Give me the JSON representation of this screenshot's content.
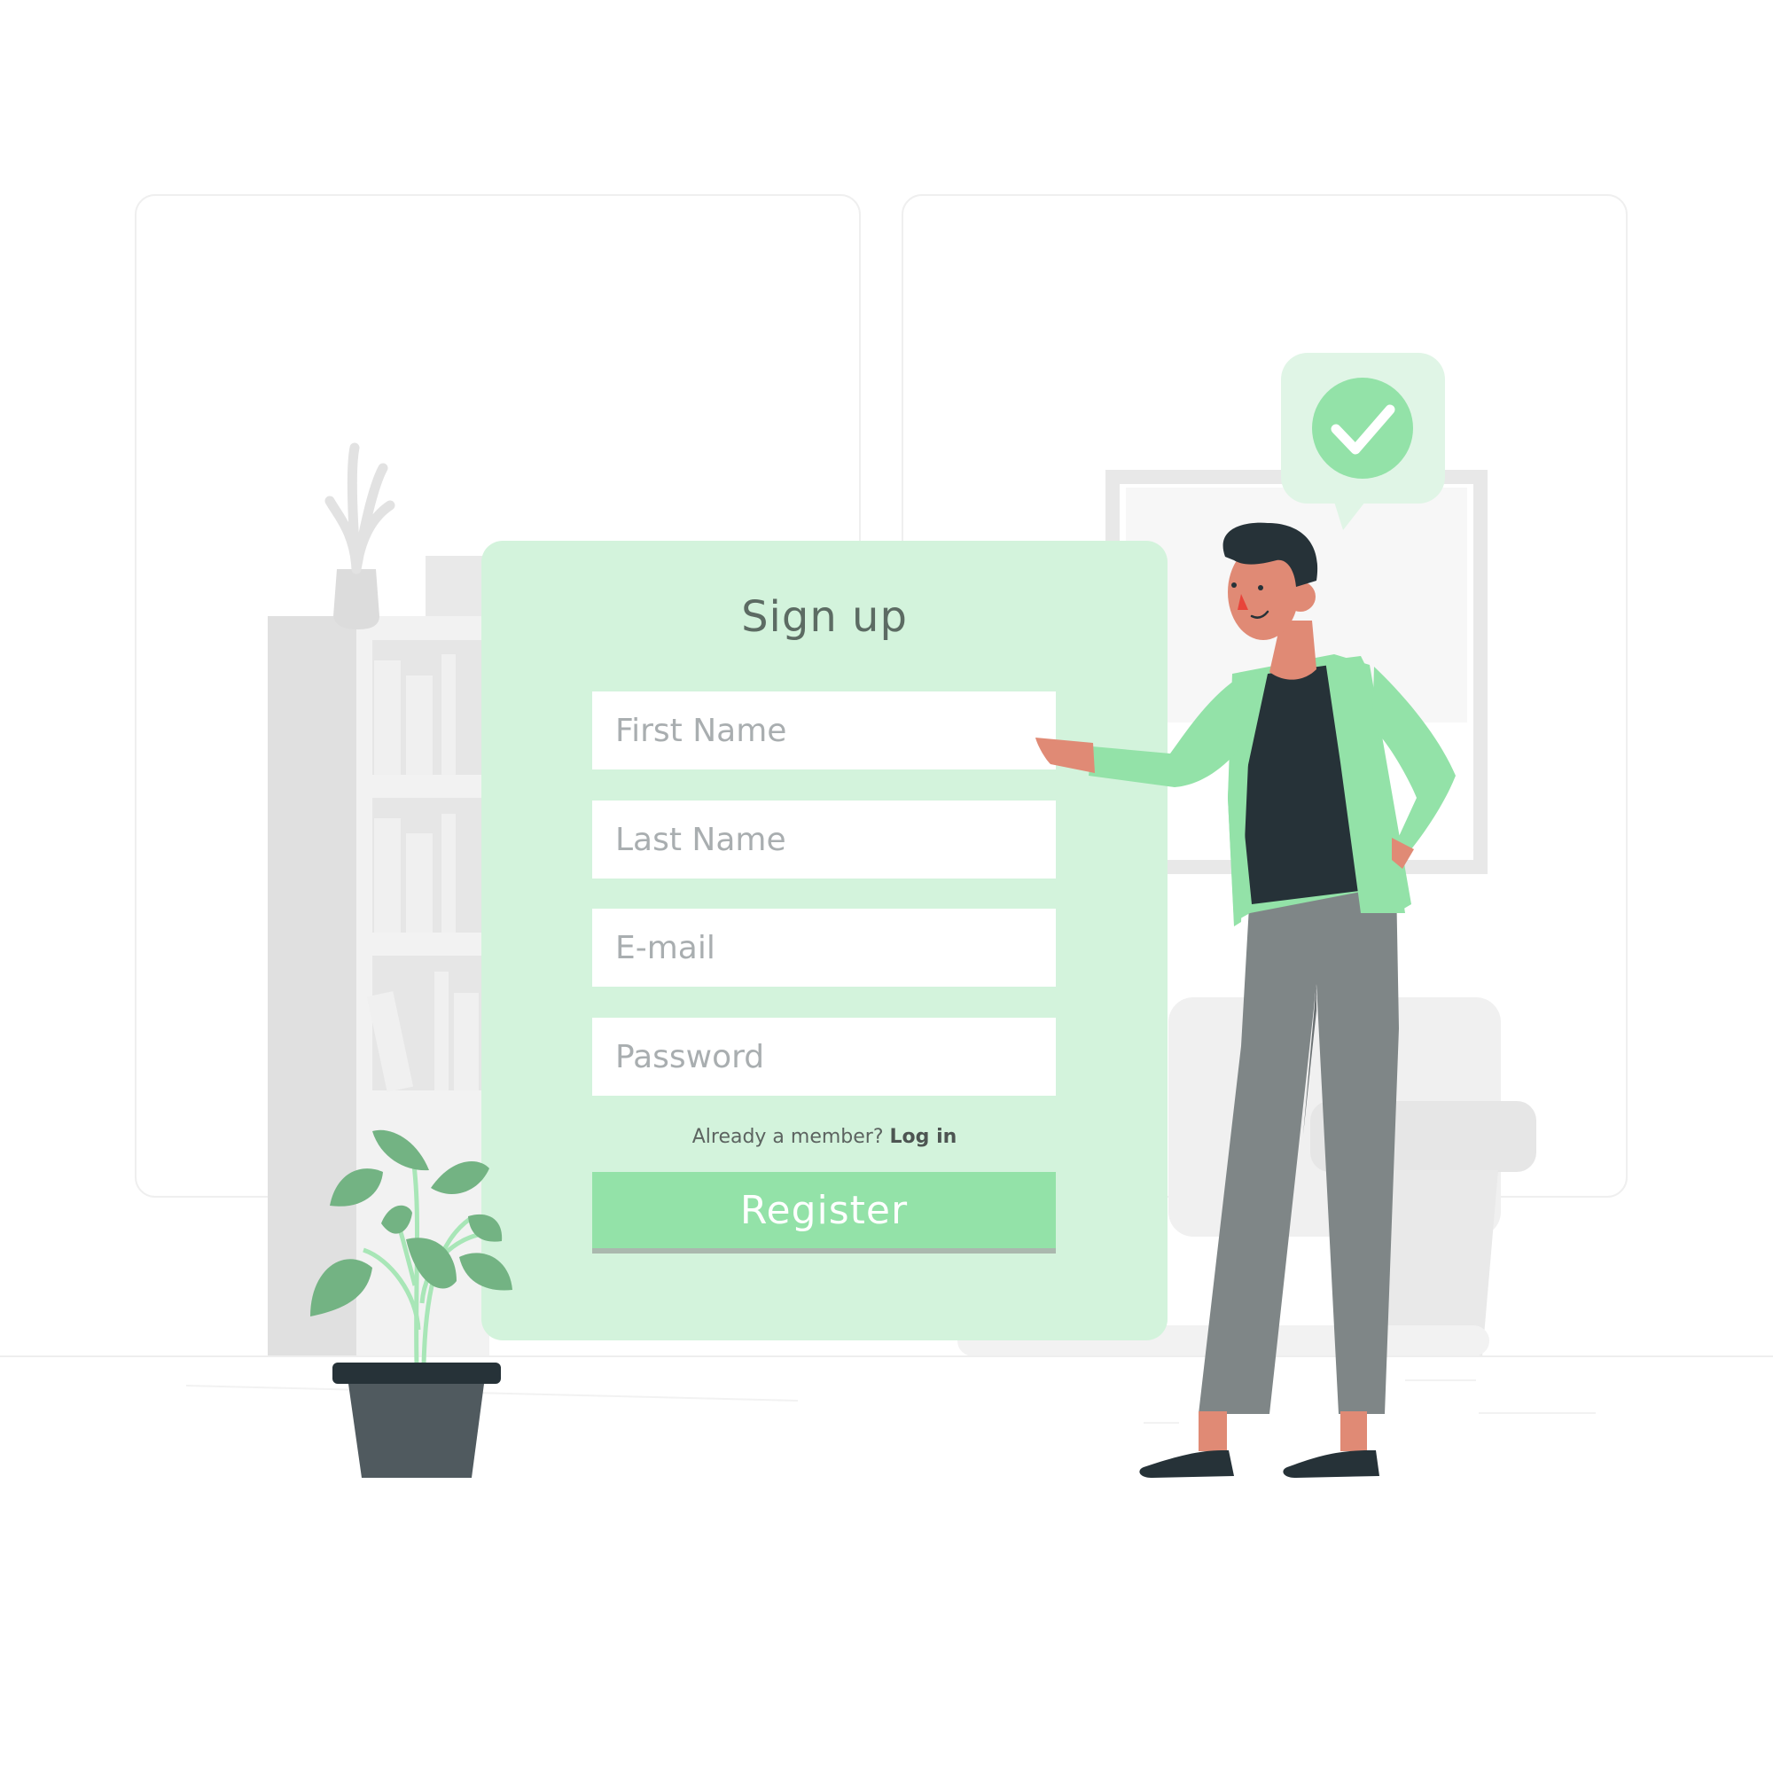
{
  "signup": {
    "title": "Sign up",
    "fields": [
      {
        "placeholder": "First Name"
      },
      {
        "placeholder": "Last Name"
      },
      {
        "placeholder": "E-mail"
      },
      {
        "placeholder": "Password"
      }
    ],
    "member_prompt": "Already a member?",
    "login_link": "Log in",
    "register_label": "Register"
  },
  "icons": {
    "speech_bubble": "checkmark-speech-bubble-icon",
    "checkmark": "check-circle-icon"
  },
  "colors": {
    "card_bg": "#d3f3dc",
    "accent_green": "#93e2a8",
    "bubble_bg": "#e0f5e6",
    "dark": "#263238",
    "skin": "#e08a75",
    "pants": "#7f8687"
  }
}
